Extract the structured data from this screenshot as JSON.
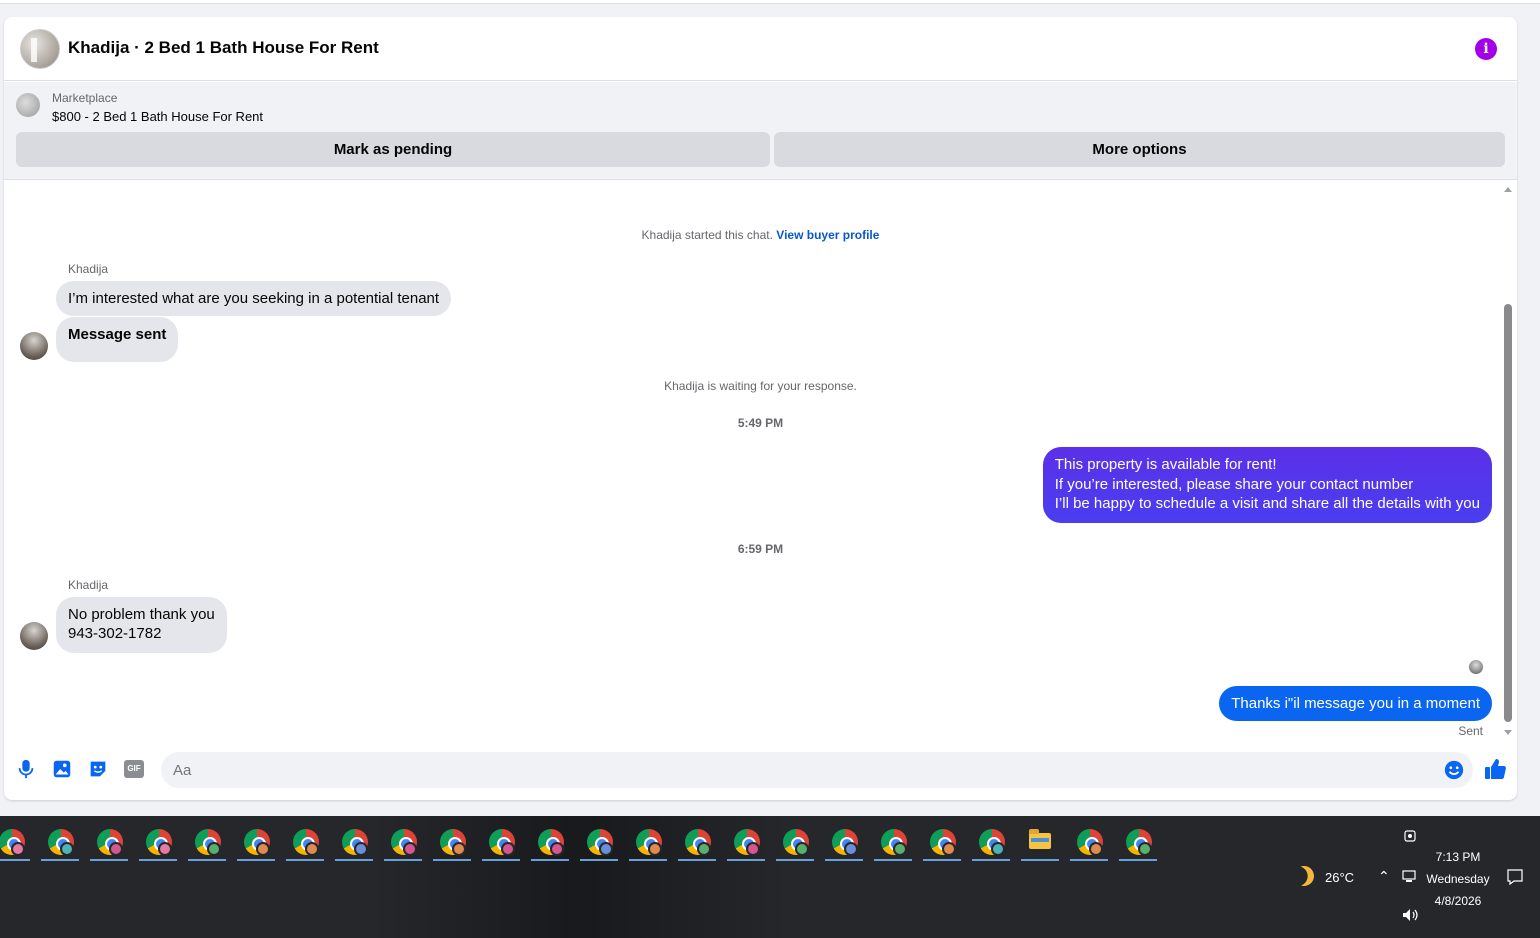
{
  "header": {
    "title": "Khadija · 2 Bed 1 Bath House For Rent",
    "info_icon": "info-icon"
  },
  "listing": {
    "label": "Marketplace",
    "price_title": "$800 - 2 Bed 1 Bath House For Rent",
    "mark_pending_label": "Mark as pending",
    "more_options_label": "More options"
  },
  "chat": {
    "started_text": "Khadija started this chat.",
    "view_profile_link": "View buyer profile",
    "sender_name": "Khadija",
    "msg1": "I’m interested what are you seeking in a potential tenant",
    "msg2": "Message sent",
    "waiting_text": "Khadija is waiting for your response.",
    "time1": "5:49 PM",
    "out_line1": "This property is available for rent!",
    "out_line2": "If you’re interested, please share your contact number",
    "out_line3": "I’ll be happy to schedule a visit and share all the details with you",
    "time2": "6:59 PM",
    "msg3_line1": "No problem thank you",
    "msg3_line2": "943-302-1782",
    "out_reply": "Thanks i\"il message you in a moment",
    "sent_status": "Sent"
  },
  "composer": {
    "placeholder": "Aa",
    "icons": [
      "microphone-icon",
      "photo-icon",
      "sticker-icon",
      "gif-icon",
      "emoji-icon",
      "thumbs-up-icon"
    ],
    "gif_label": "GIF"
  },
  "colors": {
    "outgoing_gradient_top": "#5b30e8",
    "outgoing_solid": "#0a66f0",
    "link": "#0a58ca",
    "info_purple": "#a400e8"
  },
  "taskbar": {
    "badge_colors": [
      "#e67aa2",
      "#4fb2b6",
      "#d4578f",
      "#e67aa2",
      "#58b06b",
      "#e08a50",
      "#e08a50",
      "#6a8fd8",
      "#d4578f",
      "#e08a50",
      "#d4578f",
      "#d4578f",
      "#6a8fd8",
      "#e08a50",
      "#58b06b",
      "#d4578f",
      "#58b06b",
      "#6a8fd8",
      "#58b06b",
      "#e08a50",
      "#4fb2b6",
      "#e08a50",
      "#e08a50",
      "#58b06b"
    ],
    "weather_temp": "26°C",
    "clock_time": "7:13 PM",
    "clock_day": "Wednesday",
    "clock_date": "4/8/2026"
  }
}
